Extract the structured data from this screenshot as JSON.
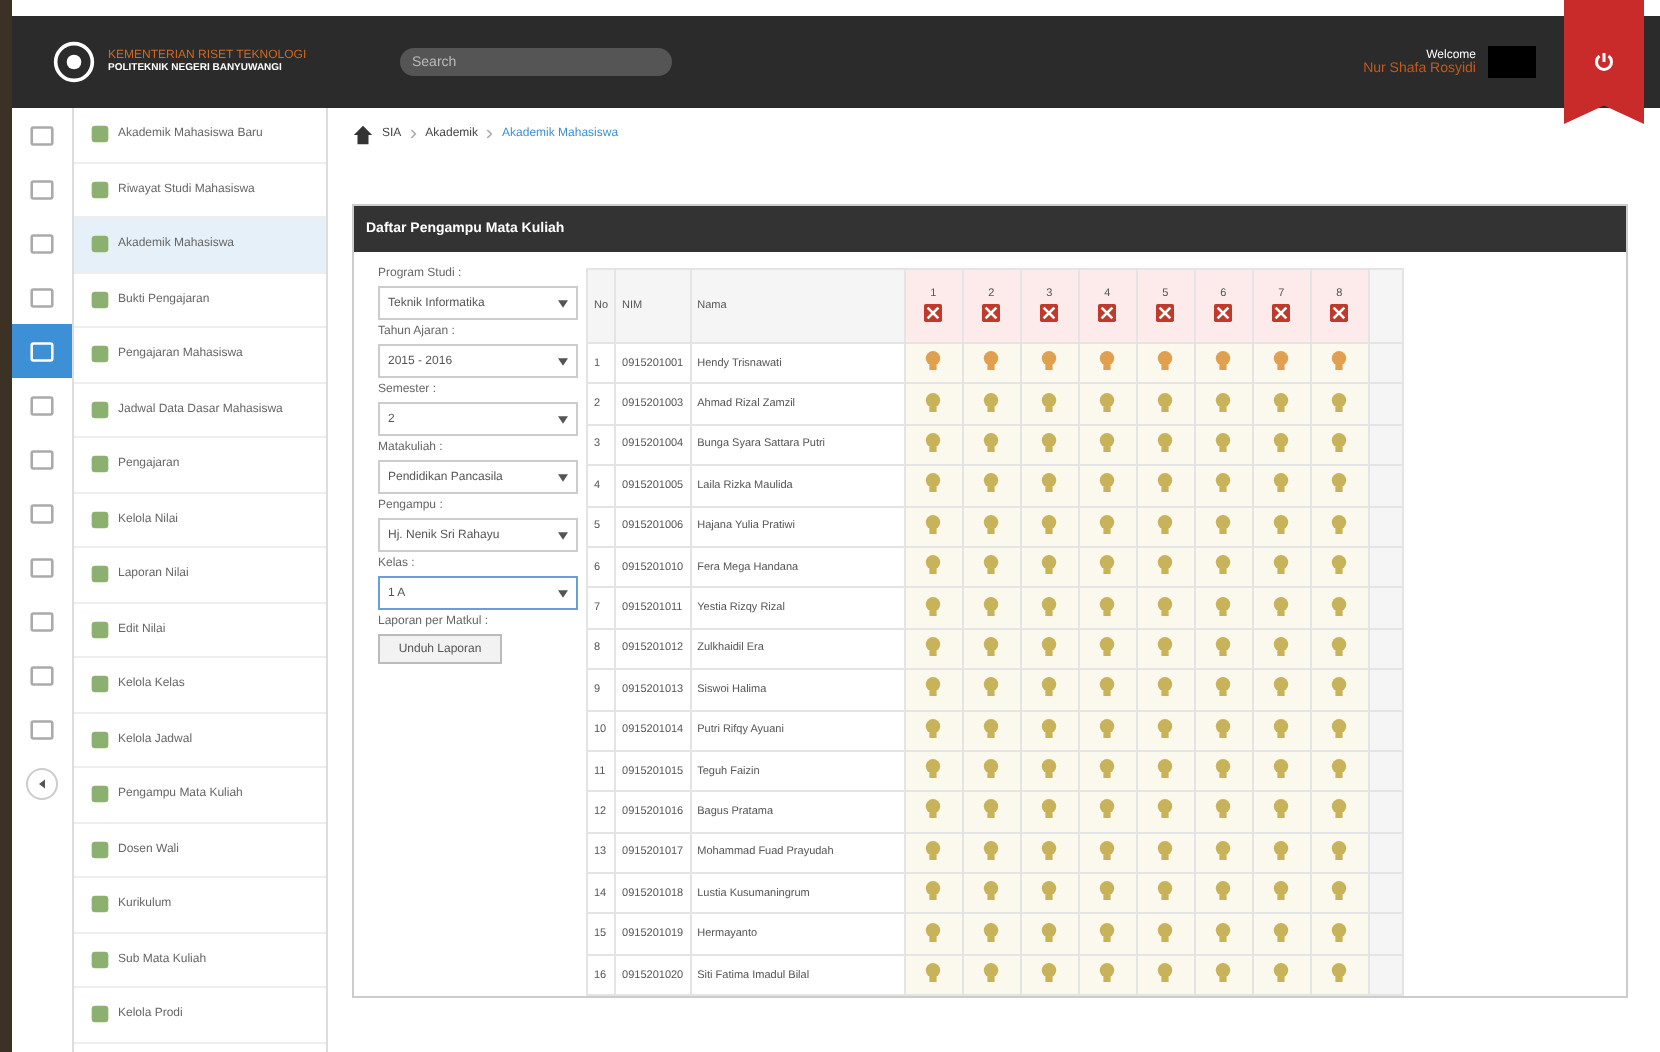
{
  "header": {
    "org_title": "KEMENTERIAN RISET TEKNOLOGI",
    "org_subtitle": "POLITEKNIK NEGERI BANYUWANGI",
    "search": {
      "placeholder": "Search"
    },
    "welcome": "Welcome",
    "user_name": "Nur Shafa Rosyidi"
  },
  "icon_rail": [
    {
      "selected": false
    },
    {
      "selected": false
    },
    {
      "selected": false
    },
    {
      "selected": false
    },
    {
      "selected": true
    },
    {
      "selected": false
    },
    {
      "selected": false
    },
    {
      "selected": false
    },
    {
      "selected": false
    },
    {
      "selected": false
    },
    {
      "selected": false
    },
    {
      "selected": false
    }
  ],
  "menu": [
    {
      "label": "Akademik Mahasiswa Baru",
      "selected": false
    },
    {
      "label": "Riwayat Studi Mahasiswa",
      "selected": false
    },
    {
      "label": "Akademik Mahasiswa",
      "selected": true
    },
    {
      "label": "Bukti Pengajaran",
      "selected": false
    },
    {
      "label": "Pengajaran Mahasiswa",
      "selected": false
    },
    {
      "label": "Jadwal Data Dasar Mahasiswa",
      "selected": false
    },
    {
      "label": "Pengajaran",
      "selected": false
    },
    {
      "label": "Kelola Nilai",
      "selected": false
    },
    {
      "label": "Laporan Nilai",
      "selected": false
    },
    {
      "label": "Edit Nilai",
      "selected": false
    },
    {
      "label": "Kelola Kelas",
      "selected": false
    },
    {
      "label": "Kelola Jadwal",
      "selected": false
    },
    {
      "label": "Pengampu Mata Kuliah",
      "selected": false
    },
    {
      "label": "Dosen Wali",
      "selected": false
    },
    {
      "label": "Kurikulum",
      "selected": false
    },
    {
      "label": "Sub Mata Kuliah",
      "selected": false
    },
    {
      "label": "Kelola Prodi",
      "selected": false
    }
  ],
  "breadcrumb": [
    "SIA",
    "Akademik",
    "Akademik Mahasiswa"
  ],
  "panel_title": "Daftar Pengampu Mata Kuliah",
  "filters": [
    {
      "label": "Program Studi :",
      "value": "Teknik Informatika",
      "focused": false
    },
    {
      "label": "Tahun Ajaran :",
      "value": "2015 - 2016",
      "focused": false
    },
    {
      "label": "Semester :",
      "value": "2",
      "focused": false
    },
    {
      "label": "Matakuliah :",
      "value": "Pendidikan Pancasila",
      "focused": false
    },
    {
      "label": "Pengampu :",
      "value": "Hj. Nenik Sri Rahayu",
      "focused": false
    },
    {
      "label": "Kelas :",
      "value": "1 A",
      "focused": true
    }
  ],
  "report_label": "Laporan per Matkul :",
  "report_button": "Unduh Laporan",
  "table": {
    "columns": [
      "No",
      "NIM",
      "Nama"
    ],
    "meetings": [
      "1",
      "2",
      "3",
      "4",
      "5",
      "6",
      "7",
      "8"
    ],
    "rows": [
      {
        "no": "1",
        "nim": "0915201001",
        "name": "Hendy Trisnawati",
        "color": "#e0a050"
      },
      {
        "no": "2",
        "nim": "0915201003",
        "name": "Ahmad Rizal Zamzil",
        "color": "#c8b25a"
      },
      {
        "no": "3",
        "nim": "0915201004",
        "name": "Bunga Syara Sattara Putri",
        "color": "#c8b25a"
      },
      {
        "no": "4",
        "nim": "0915201005",
        "name": "Laila Rizka Maulida",
        "color": "#c8b25a"
      },
      {
        "no": "5",
        "nim": "0915201006",
        "name": "Hajana Yulia Pratiwi",
        "color": "#c8b25a"
      },
      {
        "no": "6",
        "nim": "0915201010",
        "name": "Fera Mega Handana",
        "color": "#c8b25a"
      },
      {
        "no": "7",
        "nim": "0915201011",
        "name": "Yestia Rizqy Rizal",
        "color": "#c8b25a"
      },
      {
        "no": "8",
        "nim": "0915201012",
        "name": "Zulkhaidil Era",
        "color": "#c8b25a"
      },
      {
        "no": "9",
        "nim": "0915201013",
        "name": "Siswoi Halima",
        "color": "#c8b25a"
      },
      {
        "no": "10",
        "nim": "0915201014",
        "name": "Putri Rifqy Ayuani",
        "color": "#c8b25a"
      },
      {
        "no": "11",
        "nim": "0915201015",
        "name": "Teguh Faizin",
        "color": "#c8b25a"
      },
      {
        "no": "12",
        "nim": "0915201016",
        "name": "Bagus Pratama",
        "color": "#c8b25a"
      },
      {
        "no": "13",
        "nim": "0915201017",
        "name": "Mohammad Fuad Prayudah",
        "color": "#c8b25a"
      },
      {
        "no": "14",
        "nim": "0915201018",
        "name": "Lustia Kusumaningrum",
        "color": "#c8b25a"
      },
      {
        "no": "15",
        "nim": "0915201019",
        "name": "Hermayanto",
        "color": "#c8b25a"
      },
      {
        "no": "16",
        "nim": "0915201020",
        "name": "Siti Fatima Imadul Bilal",
        "color": "#c8b25a"
      }
    ]
  }
}
